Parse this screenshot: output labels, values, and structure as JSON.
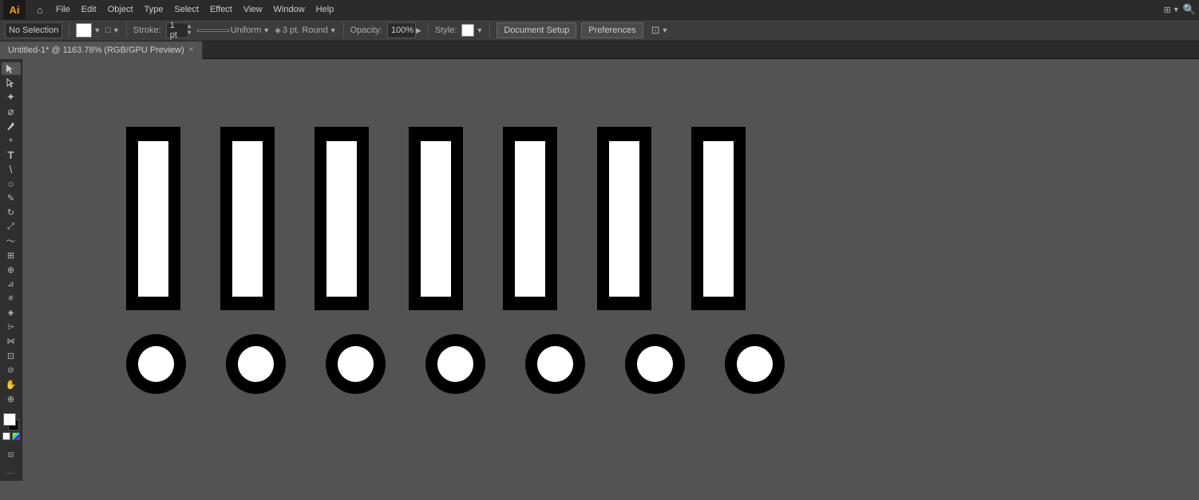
{
  "app": {
    "logo": "Ai",
    "title": "Adobe Illustrator"
  },
  "menu": {
    "items": [
      "File",
      "Edit",
      "Object",
      "Type",
      "Select",
      "Effect",
      "View",
      "Window",
      "Help"
    ]
  },
  "options_bar": {
    "selection_label": "No Selection",
    "fill_label": "",
    "stroke_label": "Stroke:",
    "stroke_weight": "1 pt",
    "stroke_type": "Uniform",
    "stroke_cap": "3 pt. Round",
    "opacity_label": "Opacity:",
    "opacity_value": "100%",
    "style_label": "Style:",
    "document_setup_btn": "Document Setup",
    "preferences_btn": "Preferences"
  },
  "tab": {
    "title": "Untitled-1* @ 1163.78% (RGB/GPU Preview)",
    "close_icon": "×"
  },
  "tools": [
    {
      "name": "selection-tool",
      "icon": "↖",
      "label": "Selection Tool"
    },
    {
      "name": "direct-selection-tool",
      "icon": "↗",
      "label": "Direct Selection"
    },
    {
      "name": "magic-wand-tool",
      "icon": "✦",
      "label": "Magic Wand"
    },
    {
      "name": "lasso-tool",
      "icon": "⌀",
      "label": "Lasso"
    },
    {
      "name": "pen-tool",
      "icon": "✒",
      "label": "Pen"
    },
    {
      "name": "add-anchor-tool",
      "icon": "+",
      "label": "Add Anchor"
    },
    {
      "name": "type-tool",
      "icon": "T",
      "label": "Type"
    },
    {
      "name": "line-tool",
      "icon": "\\",
      "label": "Line"
    },
    {
      "name": "ellipse-tool",
      "icon": "○",
      "label": "Ellipse"
    },
    {
      "name": "pencil-tool",
      "icon": "✏",
      "label": "Pencil"
    },
    {
      "name": "rotate-tool",
      "icon": "↻",
      "label": "Rotate"
    },
    {
      "name": "scale-tool",
      "icon": "⤢",
      "label": "Scale"
    },
    {
      "name": "warp-tool",
      "icon": "~",
      "label": "Warp"
    },
    {
      "name": "free-transform-tool",
      "icon": "⊞",
      "label": "Free Transform"
    },
    {
      "name": "shape-builder-tool",
      "icon": "⊕",
      "label": "Shape Builder"
    },
    {
      "name": "perspective-tool",
      "icon": "⊿",
      "label": "Perspective"
    },
    {
      "name": "mesh-tool",
      "icon": "#",
      "label": "Mesh"
    },
    {
      "name": "gradient-tool",
      "icon": "◈",
      "label": "Gradient"
    },
    {
      "name": "eyedropper-tool",
      "icon": "⌲",
      "label": "Eyedropper"
    },
    {
      "name": "blend-tool",
      "icon": "⋈",
      "label": "Blend"
    },
    {
      "name": "artboard-tool",
      "icon": "⊡",
      "label": "Artboard"
    },
    {
      "name": "slice-tool",
      "icon": "⊘",
      "label": "Slice"
    },
    {
      "name": "hand-tool",
      "icon": "✋",
      "label": "Hand"
    },
    {
      "name": "zoom-tool",
      "icon": "🔍",
      "label": "Zoom"
    }
  ],
  "canvas": {
    "rectangles": [
      {
        "id": 1
      },
      {
        "id": 2
      },
      {
        "id": 3
      },
      {
        "id": 4
      },
      {
        "id": 5
      },
      {
        "id": 6
      },
      {
        "id": 7
      }
    ],
    "circles": [
      {
        "id": 1
      },
      {
        "id": 2
      },
      {
        "id": 3
      },
      {
        "id": 4
      },
      {
        "id": 5
      },
      {
        "id": 6
      },
      {
        "id": 7
      }
    ]
  },
  "colors": {
    "bg": "#535353",
    "toolbar_bg": "#2f2f2f",
    "menubar_bg": "#2b2b2b",
    "options_bg": "#3c3c3c",
    "accent": "#ff9a00"
  }
}
